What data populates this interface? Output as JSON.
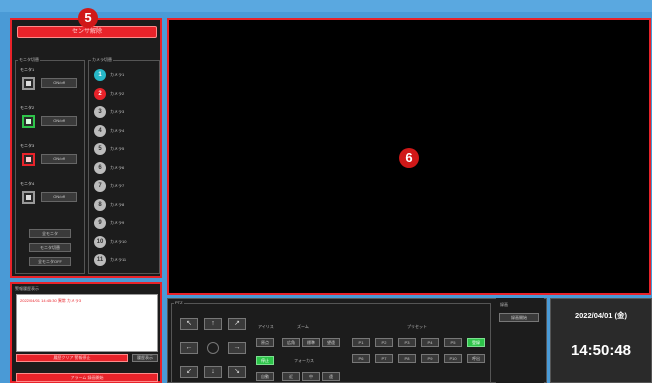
{
  "alarm": {
    "label": "センサ解除",
    "badge": "5"
  },
  "monitors": {
    "group_label": "モニタ切替",
    "items": [
      {
        "label": "モニタ1",
        "btn": "ON/off",
        "state": "normal"
      },
      {
        "label": "モニタ2",
        "btn": "ON/off",
        "state": "green"
      },
      {
        "label": "モニタ3",
        "btn": "ON/off",
        "state": "red"
      },
      {
        "label": "モニタ4",
        "btn": "ON/off",
        "state": "normal"
      }
    ],
    "extra_buttons": [
      "全モニタ",
      "モニタ切替",
      "全モニタOFF"
    ]
  },
  "cameras": {
    "group_label": "カメラ切替",
    "items": [
      {
        "num": "1",
        "label": "カメラ1",
        "style": "teal"
      },
      {
        "num": "2",
        "label": "カメラ2",
        "style": "red"
      },
      {
        "num": "3",
        "label": "カメラ3",
        "style": "gray"
      },
      {
        "num": "4",
        "label": "カメラ4",
        "style": "gray"
      },
      {
        "num": "5",
        "label": "カメラ5",
        "style": "gray"
      },
      {
        "num": "6",
        "label": "カメラ6",
        "style": "gray"
      },
      {
        "num": "7",
        "label": "カメラ7",
        "style": "gray"
      },
      {
        "num": "8",
        "label": "カメラ8",
        "style": "gray"
      },
      {
        "num": "9",
        "label": "カメラ9",
        "style": "gray"
      },
      {
        "num": "10",
        "label": "カメラ10",
        "style": "gray"
      },
      {
        "num": "11",
        "label": "カメラ11",
        "style": "gray"
      }
    ]
  },
  "log": {
    "label": "警報履歴表示",
    "entry": "2022/04/01 14:45:30 異常 カメラ3",
    "red_btn": "履歴クリア 警報停止",
    "gray_btn": "履歴表示",
    "bottom_btn": "アラーム 録画開始"
  },
  "video": {
    "badge": "6"
  },
  "ptz": {
    "group_label": "PTZ",
    "zoom_label": "ズーム",
    "focus_label": "フォーカス",
    "iris_label": "アイリス",
    "preset_label": "プリセット",
    "home": "原点",
    "stop": "停止",
    "auto": "自動",
    "manual": "手動",
    "wide": "広角",
    "std": "標準",
    "tele": "望遠",
    "near": "近",
    "mid": "中",
    "far": "遠",
    "preset_btns": [
      "P1",
      "P2",
      "P3",
      "P4",
      "P5",
      "登録",
      "P6",
      "P7",
      "P8",
      "P9",
      "P10",
      "呼出"
    ]
  },
  "preset_panel": {
    "label": "録画",
    "btn": "録画開始"
  },
  "clock": {
    "date": "2022/04/01 (金)",
    "time": "14:50:48"
  }
}
